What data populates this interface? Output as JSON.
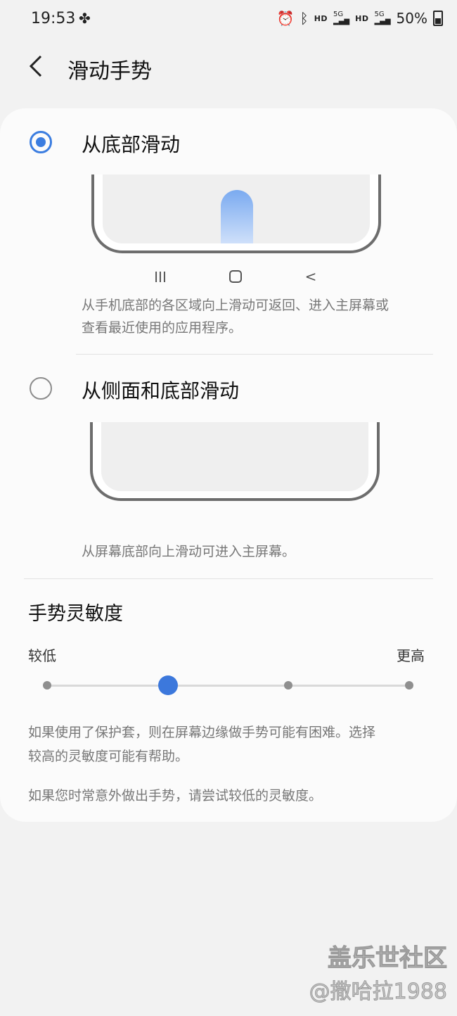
{
  "status": {
    "time": "19:53",
    "battery": "50%"
  },
  "header": {
    "title": "滑动手势"
  },
  "options": [
    {
      "label": "从底部滑动",
      "selected": true,
      "nav_buttons": [
        "III",
        "O",
        "<"
      ],
      "description_line1": "从手机底部的各区域向上滑动可返回、进入主屏幕或",
      "description_line2": "查看最近使用的应用程序。"
    },
    {
      "label": "从侧面和底部滑动",
      "selected": false,
      "description": "从屏幕底部向上滑动可进入主屏幕。"
    }
  ],
  "sensitivity": {
    "title": "手势灵敏度",
    "low_label": "较低",
    "high_label": "更高",
    "level_index": 1,
    "level_count": 4
  },
  "notes": {
    "note1_line1": "如果使用了保护套，则在屏幕边缘做手势可能有困难。选择",
    "note1_line2": "较高的灵敏度可能有帮助。",
    "note2": "如果您时常意外做出手势，请尝试较低的灵敏度。"
  },
  "watermark": {
    "line1": "盖乐世社区",
    "line2": "@撒哈拉1988"
  },
  "colors": {
    "accent": "#3b7de0",
    "background": "#f2f2f2",
    "card": "#fbfbfb"
  }
}
